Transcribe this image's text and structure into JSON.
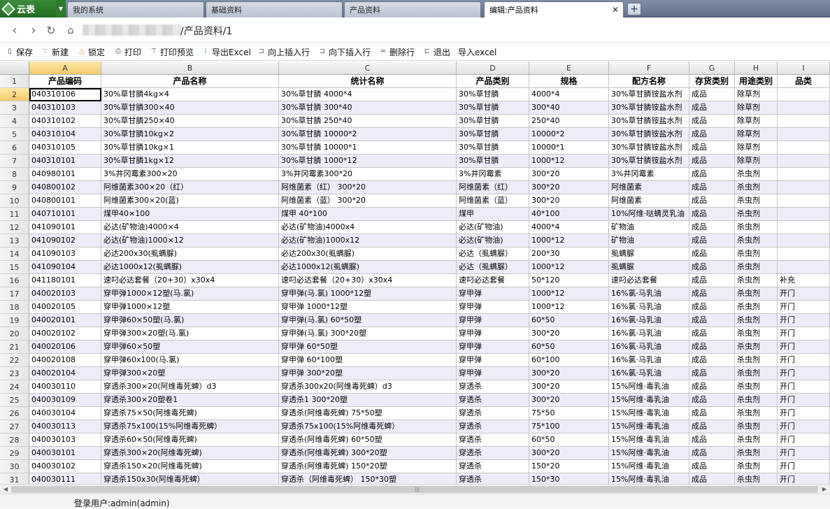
{
  "app": {
    "brand": "云表"
  },
  "tabs": [
    {
      "label": "我的系统"
    },
    {
      "label": "基础资料"
    },
    {
      "label": "产品资料"
    },
    {
      "label": "编辑:产品资料",
      "active": true
    }
  ],
  "nav": {
    "path": "/产品资料/1"
  },
  "toolbar": {
    "save": "保存",
    "new": "新建",
    "lock": "锁定",
    "print": "打印",
    "print_preview": "打印预览",
    "export_excel": "导出Excel",
    "insert_above": "向上插入行",
    "insert_below": "向下插入行",
    "delete_row": "删除行",
    "exit": "退出",
    "import_excel": "导入excel"
  },
  "grid": {
    "columns": [
      "A",
      "B",
      "C",
      "D",
      "E",
      "F",
      "G",
      "H",
      "I"
    ],
    "header_row": [
      "产品编码",
      "产品名称",
      "统计名称",
      "产品类别",
      "规格",
      "配方名称",
      "存货类别",
      "用途类别",
      "品类"
    ],
    "rows": [
      [
        "040310106",
        "30%草甘膦4kg×4",
        "30%草甘膦  4000*4",
        "30%草甘膦",
        "4000*4",
        "30%草甘膦铵盐水剂",
        "成品",
        "除草剂",
        ""
      ],
      [
        "040310103",
        "30%草甘膦300×40",
        "30%草甘膦  300*40",
        "30%草甘膦",
        "300*40",
        "30%草甘膦铵盐水剂",
        "成品",
        "除草剂",
        ""
      ],
      [
        "040310102",
        "30%草甘膦250×40",
        "30%草甘膦  250*40",
        "30%草甘膦",
        "250*40",
        "30%草甘膦铵盐水剂",
        "成品",
        "除草剂",
        ""
      ],
      [
        "040310104",
        "30%草甘膦10kg×2",
        "30%草甘膦  10000*2",
        "30%草甘膦",
        "10000*2",
        "30%草甘膦铵盐水剂",
        "成品",
        "除草剂",
        ""
      ],
      [
        "040310105",
        "30%草甘膦10kg×1",
        "30%草甘膦  10000*1",
        "30%草甘膦",
        "10000*1",
        "30%草甘膦铵盐水剂",
        "成品",
        "除草剂",
        ""
      ],
      [
        "040310101",
        "30%草甘膦1kg×12",
        "30%草甘膦  1000*12",
        "30%草甘膦",
        "1000*12",
        "30%草甘膦铵盐水剂",
        "成品",
        "除草剂",
        ""
      ],
      [
        "040980101",
        "3%井冈霉素300×20",
        "3%井冈霉素300*20",
        "3%井冈霉素",
        "300*20",
        "3%井冈霉素",
        "成品",
        "杀虫剂",
        ""
      ],
      [
        "040800102",
        "阿维菌素300×20（红）",
        "阿维菌素（红）  300*20",
        "阿维菌素（红）",
        "300*20",
        "阿维菌素",
        "成品",
        "杀虫剂",
        ""
      ],
      [
        "040800101",
        "阿维菌素300×20(蓝)",
        "阿维菌素（蓝）  300*20",
        "阿维菌素（蓝）",
        "300*20",
        "阿维菌素",
        "成品",
        "杀虫剂",
        ""
      ],
      [
        "040710101",
        "煤甲40×100",
        "煤甲  40*100",
        "煤甲",
        "40*100",
        "10%阿维·哒螨灵乳油",
        "成品",
        "杀虫剂",
        ""
      ],
      [
        "041090101",
        "必达(矿物油)4000×4",
        "必达(矿物油)4000x4",
        "必达(矿物油)",
        "4000*4",
        "矿物油",
        "成品",
        "杀虫剂",
        ""
      ],
      [
        "041090102",
        "必达(矿物油)1000×12",
        "必达(矿物油)1000x12",
        "必达(矿物油)",
        "1000*12",
        "矿物油",
        "成品",
        "杀虫剂",
        ""
      ],
      [
        "041090103",
        "必达200x30(虱螨脲)",
        "必达200x30(虱螨脲)",
        "必达（虱螨脲）",
        "200*30",
        "虱螨脲",
        "成品",
        "杀虫剂",
        ""
      ],
      [
        "041090104",
        "必达1000x12(虱螨脲)",
        "必达1000x12(虱螨脲)",
        "必达（虱螨脲）",
        "1000*12",
        "虱螨脲",
        "成品",
        "杀虫剂",
        ""
      ],
      [
        "041180101",
        "速叼必达套餐（20+30）x30x4",
        "速叼必达套餐（20+30）x30x4",
        "速叼必达套餐",
        "50*120",
        "速叼必达套餐",
        "成品",
        "杀虫剂",
        "补充"
      ],
      [
        "040020103",
        "穿甲弹1000×12塑(马.氯)",
        "穿甲弹(马.氯) 1000*12塑",
        "穿甲弹",
        "1000*12",
        "16%氯·马乳油",
        "成品",
        "杀虫剂",
        "开门"
      ],
      [
        "040020105",
        "穿甲弹1000×12塑",
        "穿甲弹  1000*12塑",
        "穿甲弹",
        "1000*12",
        "16%氯·马乳油",
        "成品",
        "杀虫剂",
        "开门"
      ],
      [
        "040020101",
        "穿甲弹60×50塑(马.氯)",
        "穿甲弹(马.氯) 60*50塑",
        "穿甲弹",
        "60*50",
        "16%氯·马乳油",
        "成品",
        "杀虫剂",
        "开门"
      ],
      [
        "040020102",
        "穿甲弹300×20塑(马.氯)",
        "穿甲弹(马.氯) 300*20塑",
        "穿甲弹",
        "300*20",
        "16%氯·马乳油",
        "成品",
        "杀虫剂",
        "开门"
      ],
      [
        "040020106",
        "穿甲弹60×50塑",
        "穿甲弹  60*50塑",
        "穿甲弹",
        "60*50",
        "16%氯·马乳油",
        "成品",
        "杀虫剂",
        "开门"
      ],
      [
        "040020108",
        "穿甲弹60x100(马.氯)",
        "穿甲弹  60*100塑",
        "穿甲弹",
        "60*100",
        "16%氯·马乳油",
        "成品",
        "杀虫剂",
        "开门"
      ],
      [
        "040020104",
        "穿甲弹300×20塑",
        "穿甲弹  300*20塑",
        "穿甲弹",
        "300*20",
        "16%氯·马乳油",
        "成品",
        "杀虫剂",
        "开门"
      ],
      [
        "040030110",
        "穿透杀300×20(阿维毒死蜱）d3",
        "穿透杀300x20(阿维毒死蜱）d3",
        "穿透杀",
        "300*20",
        "15%阿维·毒乳油",
        "成品",
        "杀虫剂",
        "开门"
      ],
      [
        "040030109",
        "穿透杀300×20塑卷1",
        "穿透杀1  300*20塑",
        "穿透杀",
        "300*20",
        "15%阿维·毒乳油",
        "成品",
        "杀虫剂",
        "开门"
      ],
      [
        "040030104",
        "穿透杀75×50(阿维毒死蜱)",
        "穿透杀(阿维毒死蜱)  75*50塑",
        "穿透杀",
        "75*50",
        "15%阿维·毒乳油",
        "成品",
        "杀虫剂",
        "开门"
      ],
      [
        "040030113",
        "穿透杀75x100(15%阿维毒死蜱）",
        "穿透杀75x100(15%阿维毒死蜱）",
        "穿透杀",
        "75*100",
        "15%阿维·毒乳油",
        "成品",
        "杀虫剂",
        "开门"
      ],
      [
        "040030103",
        "穿透杀60×50(阿维毒死蜱)",
        "穿透杀(阿维毒死蜱)  60*50塑",
        "穿透杀",
        "60*50",
        "15%阿维·毒乳油",
        "成品",
        "杀虫剂",
        "开门"
      ],
      [
        "040030101",
        "穿透杀300×20(阿维毒死蜱)",
        "穿透杀(阿维毒死蜱)  300*20塑",
        "穿透杀",
        "300*20",
        "15%阿维·毒乳油",
        "成品",
        "杀虫剂",
        "开门"
      ],
      [
        "040030102",
        "穿透杀150×20(阿维毒死蜱)",
        "穿透杀(阿维毒死蜱)  150*20塑",
        "穿透杀",
        "150*20",
        "15%阿维·毒乳油",
        "成品",
        "杀虫剂",
        "开门"
      ],
      [
        "040030111",
        "穿透杀150x30(阿维毒死蜱）",
        "穿透杀（阿维毒死蜱）  150*30塑",
        "穿透杀",
        "150*30",
        "15%阿维·毒乳油",
        "成品",
        "杀虫剂",
        "开门"
      ]
    ]
  },
  "status": {
    "login_user": "登录用户:admin(admin)"
  },
  "colors": {
    "alt_row": "#ededf9",
    "selection": "#f4c96a"
  }
}
